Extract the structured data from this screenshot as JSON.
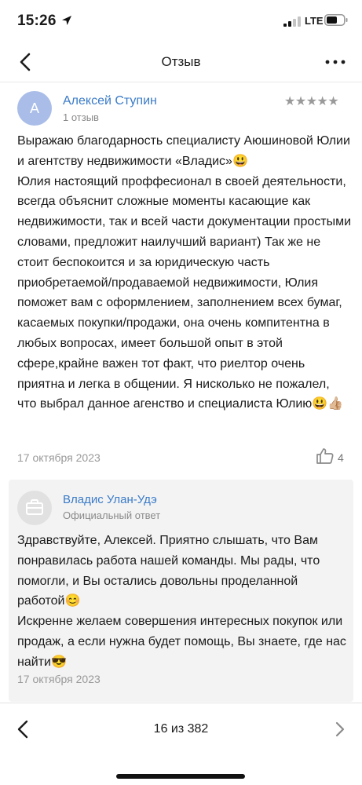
{
  "status_bar": {
    "time": "15:26",
    "network": "LTE",
    "location_icon": "location-arrow-icon",
    "signal_icon": "cellular-signal-icon",
    "battery_icon": "battery-icon"
  },
  "nav": {
    "title": "Отзыв",
    "back_icon": "chevron-left-icon",
    "more_icon": "more-dots-icon"
  },
  "review": {
    "avatar_letter": "А",
    "author": "Алексей Ступин",
    "author_reviews": "1 отзыв",
    "stars": "★★★★★",
    "rating": 5,
    "text": "Выражаю благодарность специалисту Аюшиновой Юлии и агентству недвижимости «Владис»😃\nЮлия настоящий проффесионал в своей деятельности, всегда объяснит сложные моменты касающие как недвижимости, так и всей части документации простыми словами, предложит наилучший вариант) Так же не стоит беспокоится и за юридическую часть приобретаемой/продаваемой недвижимости, Юлия поможет вам с оформлением, заполнением всех бумаг, касаемых покупки/продажи, она очень компитентна в любых вопросах, имеет большой опыт в этой сфере,крайне важен тот факт, что риелтор очень приятна и легка в общении. Я нисколько не пожалел, что выбрал данное агенство и специалиста Юлию😃👍🏼",
    "date": "17 октября 2023",
    "likes": "4",
    "like_icon": "thumbs-up-icon"
  },
  "reply": {
    "org_icon": "briefcase-icon",
    "org_name": "Владис Улан-Удэ",
    "org_sub": "Официальный ответ",
    "text": "Здравствуйте, Алексей. Приятно слышать, что Вам понравилась работа нашей команды. Мы рады, что помогли, и Вы остались довольны проделанной работой😊\nИскренне желаем совершения интересных покупок или продаж, а если нужна будет помощь, Вы знаете, где нас найти😎",
    "date": "17 октября 2023"
  },
  "pager": {
    "text": "16 из 382",
    "prev_icon": "chevron-left-icon",
    "next_icon": "chevron-right-icon"
  },
  "colors": {
    "link_blue": "#3a7bc8",
    "avatar_bg": "#a9bde8",
    "reply_bg": "#f3f3f3",
    "muted_text": "#8a8a8a"
  }
}
